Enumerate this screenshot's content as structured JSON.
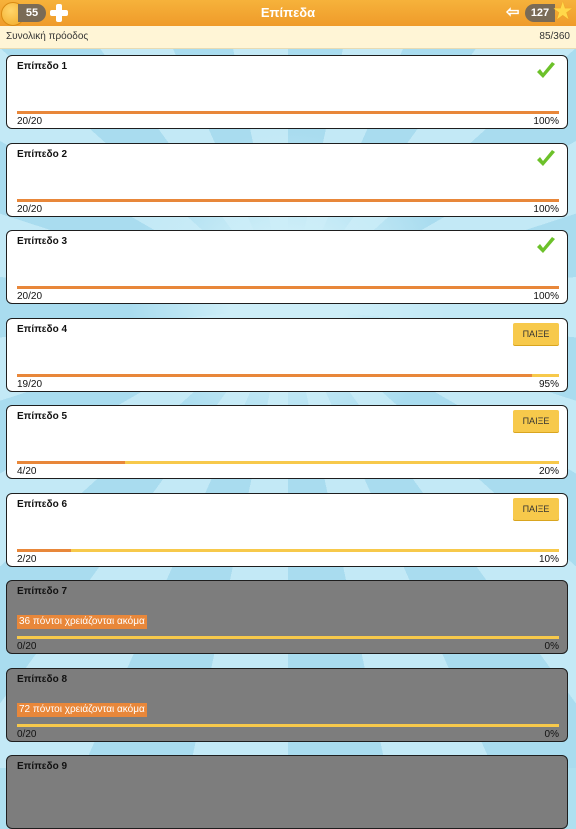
{
  "header": {
    "title": "Επίπεδα",
    "coins": "55",
    "stars": "127"
  },
  "overall": {
    "label": "Συνολική πρόοδος",
    "value": "85/360"
  },
  "levels": [
    {
      "name": "Επίπεδο 1",
      "count": "20/20",
      "percent": "100%",
      "progress": 1.0,
      "state": "done"
    },
    {
      "name": "Επίπεδο 2",
      "count": "20/20",
      "percent": "100%",
      "progress": 1.0,
      "state": "done"
    },
    {
      "name": "Επίπεδο 3",
      "count": "20/20",
      "percent": "100%",
      "progress": 1.0,
      "state": "done"
    },
    {
      "name": "Επίπεδο 4",
      "count": "19/20",
      "percent": "95%",
      "progress": 0.95,
      "state": "play",
      "play_label": "ΠΑΙΞΕ"
    },
    {
      "name": "Επίπεδο 5",
      "count": "4/20",
      "percent": "20%",
      "progress": 0.2,
      "state": "play",
      "play_label": "ΠΑΙΞΕ"
    },
    {
      "name": "Επίπεδο 6",
      "count": "2/20",
      "percent": "10%",
      "progress": 0.1,
      "state": "play",
      "play_label": "ΠΑΙΞΕ"
    },
    {
      "name": "Επίπεδο 7",
      "count": "0/20",
      "percent": "0%",
      "progress": 0.0,
      "state": "locked",
      "need": "36 πόντοι χρειάζονται ακόμα"
    },
    {
      "name": "Επίπεδο 8",
      "count": "0/20",
      "percent": "0%",
      "progress": 0.0,
      "state": "locked",
      "need": "72 πόντοι χρειάζονται ακόμα"
    },
    {
      "name": "Επίπεδο 9",
      "count": "",
      "percent": "",
      "progress": 0.0,
      "state": "locked"
    }
  ],
  "colors": {
    "topbar": "#f2a631",
    "accent_fill": "#e8873a",
    "track": "#f7c94b",
    "check": "#6cc12a",
    "locked_card": "#7d7d7d"
  },
  "icons": {
    "coin": "coin-icon",
    "plus": "plus-icon",
    "back": "back-arrow-icon",
    "star": "star-icon",
    "check": "check-icon"
  }
}
